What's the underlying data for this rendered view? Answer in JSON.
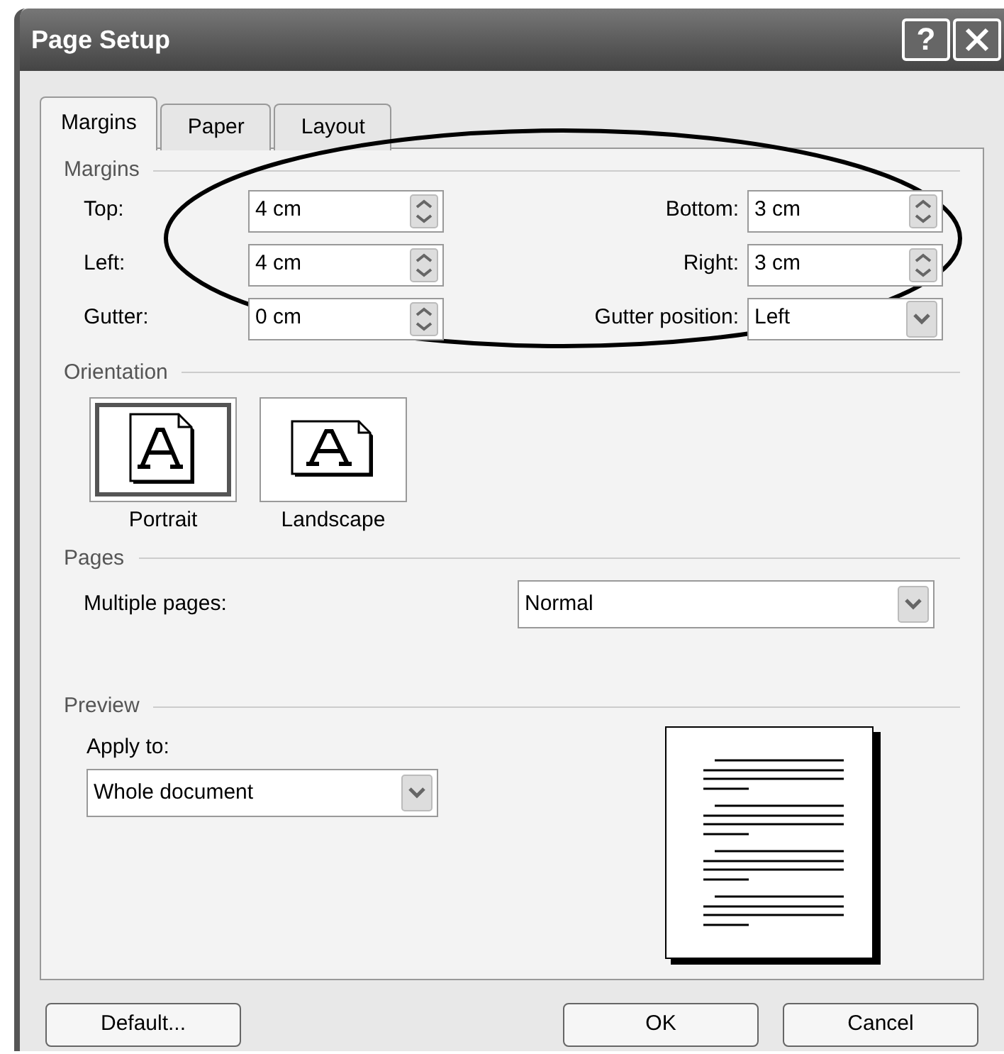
{
  "window": {
    "title": "Page Setup",
    "help": "?"
  },
  "tabs": [
    {
      "label": "Margins",
      "selected": true
    },
    {
      "label": "Paper",
      "selected": false
    },
    {
      "label": "Layout",
      "selected": false
    }
  ],
  "margins": {
    "title": "Margins",
    "left_fields": [
      {
        "label": "Top:",
        "value": "4 cm",
        "kind": "spin"
      },
      {
        "label": "Left:",
        "value": "4 cm",
        "kind": "spin"
      },
      {
        "label": "Gutter:",
        "value": "0 cm",
        "kind": "spin"
      }
    ],
    "right_fields": [
      {
        "label": "Bottom:",
        "value": "3 cm",
        "kind": "spin"
      },
      {
        "label": "Right:",
        "value": "3 cm",
        "kind": "spin"
      },
      {
        "label": "Gutter position:",
        "value": "Left",
        "kind": "dropdown"
      }
    ]
  },
  "orientation": {
    "title": "Orientation",
    "options": [
      {
        "label": "Portrait",
        "kind": "portrait",
        "selected": true
      },
      {
        "label": "Landscape",
        "kind": "landscape",
        "selected": false
      }
    ]
  },
  "pages": {
    "title": "Pages",
    "label": "Multiple pages:",
    "value": "Normal"
  },
  "preview": {
    "title": "Preview",
    "apply_label": "Apply to:",
    "apply_value": "Whole document"
  },
  "buttons": [
    {
      "label": "Default...",
      "kind": "left"
    },
    {
      "label": "OK",
      "kind": "right"
    },
    {
      "label": "Cancel",
      "kind": "right"
    }
  ]
}
